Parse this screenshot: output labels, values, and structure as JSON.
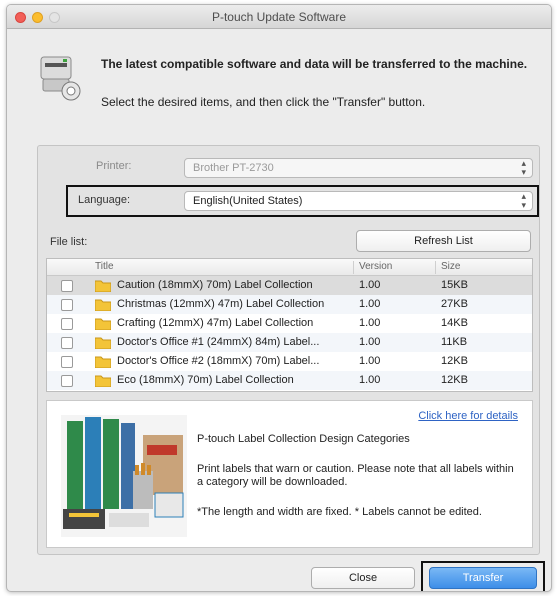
{
  "window": {
    "title": "P-touch Update Software"
  },
  "header": {
    "bold_text": "The latest compatible software and data will be transferred to the machine.",
    "sub_text": "Select the desired items, and then click the \"Transfer\" button."
  },
  "printer": {
    "label": "Printer:",
    "value": "Brother PT-2730"
  },
  "language": {
    "label": "Language:",
    "value": "English(United States)"
  },
  "file_list": {
    "label": "File list:",
    "refresh_label": "Refresh List",
    "columns": [
      "Title",
      "Version",
      "Size"
    ],
    "rows": [
      {
        "title": "Caution (18mmX) 70m) Label Collection",
        "version": "1.00",
        "size": "15KB"
      },
      {
        "title": "Christmas (12mmX) 47m) Label Collection",
        "version": "1.00",
        "size": "27KB"
      },
      {
        "title": "Crafting (12mmX) 47m) Label Collection",
        "version": "1.00",
        "size": "14KB"
      },
      {
        "title": "Doctor's Office #1 (24mmX) 84m) Label...",
        "version": "1.00",
        "size": "11KB"
      },
      {
        "title": "Doctor's Office #2 (18mmX) 70m) Label...",
        "version": "1.00",
        "size": "12KB"
      },
      {
        "title": "Eco (18mmX) 70m) Label Collection",
        "version": "1.00",
        "size": "12KB"
      }
    ]
  },
  "preview": {
    "link": "Click here for details",
    "heading": "P-touch Label Collection Design Categories",
    "description": "Print labels that warn or caution. Please note that all labels within a category will be downloaded.",
    "note": "*The length and width are fixed. * Labels cannot be edited."
  },
  "buttons": {
    "close": "Close",
    "transfer": "Transfer"
  },
  "colors": {
    "accent": "#3d8ee8",
    "folder": "#f3c438",
    "highlight": "#111111"
  }
}
